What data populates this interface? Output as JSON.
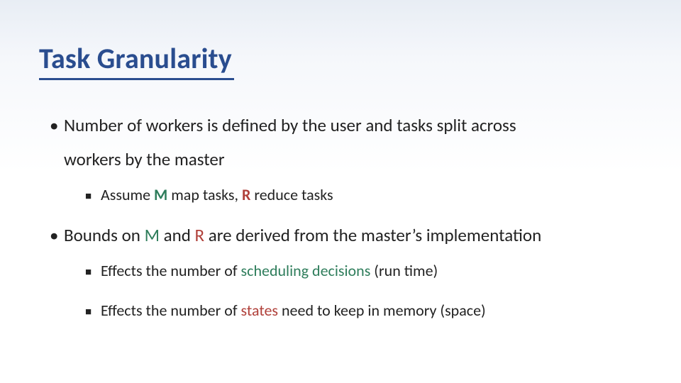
{
  "title": "Task Granularity",
  "b1": {
    "pre": "Number of workers is defined by the user and tasks split across",
    "line2": "workers by the master",
    "sub": {
      "t1": "Assume ",
      "m": "M",
      "mid1": " map tasks, ",
      "r": "R",
      "t2": " reduce tasks"
    }
  },
  "b2": {
    "t1": "Bounds on ",
    "m": "M",
    "mid": " and ",
    "r": "R",
    "t2": " are derived from the master’s implementation",
    "sub1": {
      "t1": "Effects the number of ",
      "hl": "scheduling decisions",
      "t2": " (run time)"
    },
    "sub2": {
      "t1": "Effects the number of ",
      "hl": "states",
      "t2": " need to keep in memory (space)"
    }
  }
}
